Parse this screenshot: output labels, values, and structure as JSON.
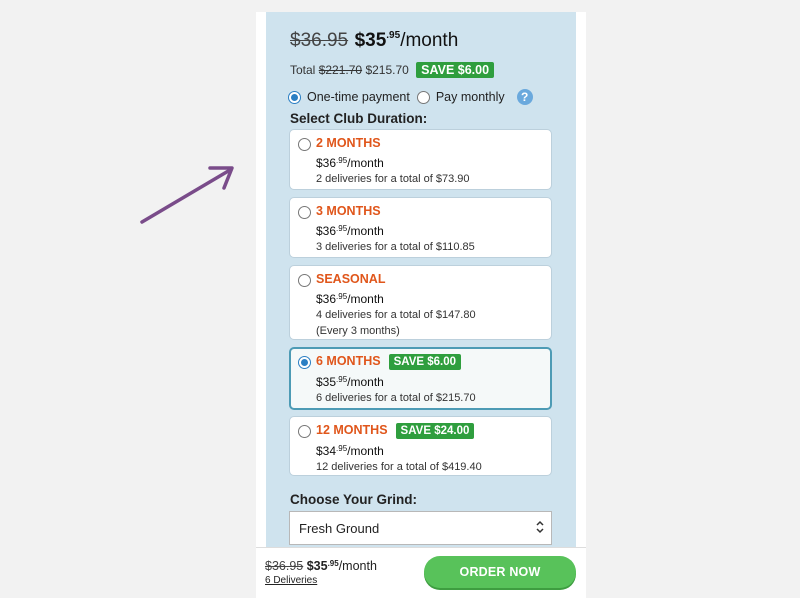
{
  "header": {
    "old_price": "$36.95",
    "new_price_dollars": "$35",
    "new_price_cents": ".95",
    "per_month": "/month",
    "total_label": "Total",
    "total_old": "$221.70",
    "total_new": "$215.70",
    "save_badge": "SAVE $6.00"
  },
  "payment": {
    "options": [
      {
        "label": "One-time payment",
        "checked": true
      },
      {
        "label": "Pay monthly",
        "checked": false
      }
    ],
    "help_icon": "question-circle-icon"
  },
  "duration": {
    "title": "Select Club Duration:",
    "options": [
      {
        "name": "2 MONTHS",
        "badge": "",
        "price_dollars": "$36",
        "price_cents": ".95",
        "per": "/month",
        "detail": "2 deliveries for a total of $73.90",
        "extra": "",
        "selected": false
      },
      {
        "name": "3 MONTHS",
        "badge": "",
        "price_dollars": "$36",
        "price_cents": ".95",
        "per": "/month",
        "detail": "3 deliveries for a total of $110.85",
        "extra": "",
        "selected": false
      },
      {
        "name": "SEASONAL",
        "badge": "",
        "price_dollars": "$36",
        "price_cents": ".95",
        "per": "/month",
        "detail": "4 deliveries for a total of $147.80",
        "extra": "(Every 3 months)",
        "selected": false
      },
      {
        "name": "6 MONTHS",
        "badge": "SAVE $6.00",
        "price_dollars": "$35",
        "price_cents": ".95",
        "per": "/month",
        "detail": "6 deliveries for a total of $215.70",
        "extra": "",
        "selected": true
      },
      {
        "name": "12 MONTHS",
        "badge": "SAVE $24.00",
        "price_dollars": "$34",
        "price_cents": ".95",
        "per": "/month",
        "detail": "12 deliveries for a total of $419.40",
        "extra": "",
        "selected": false
      }
    ]
  },
  "grind": {
    "title": "Choose Your Grind:",
    "selected": "Fresh Ground"
  },
  "bottom_bar": {
    "old_price": "$36.95",
    "new_price_dollars": "$35",
    "new_price_cents": ".95",
    "per_month": "/month",
    "deliveries_link": "6 Deliveries",
    "order_button": "ORDER NOW"
  },
  "colors": {
    "accent_orange": "#e0561b",
    "save_green": "#2f9e3e",
    "order_green": "#58c25a",
    "panel_blue": "#cfe3ee",
    "arrow_purple": "#7a4c8a"
  }
}
